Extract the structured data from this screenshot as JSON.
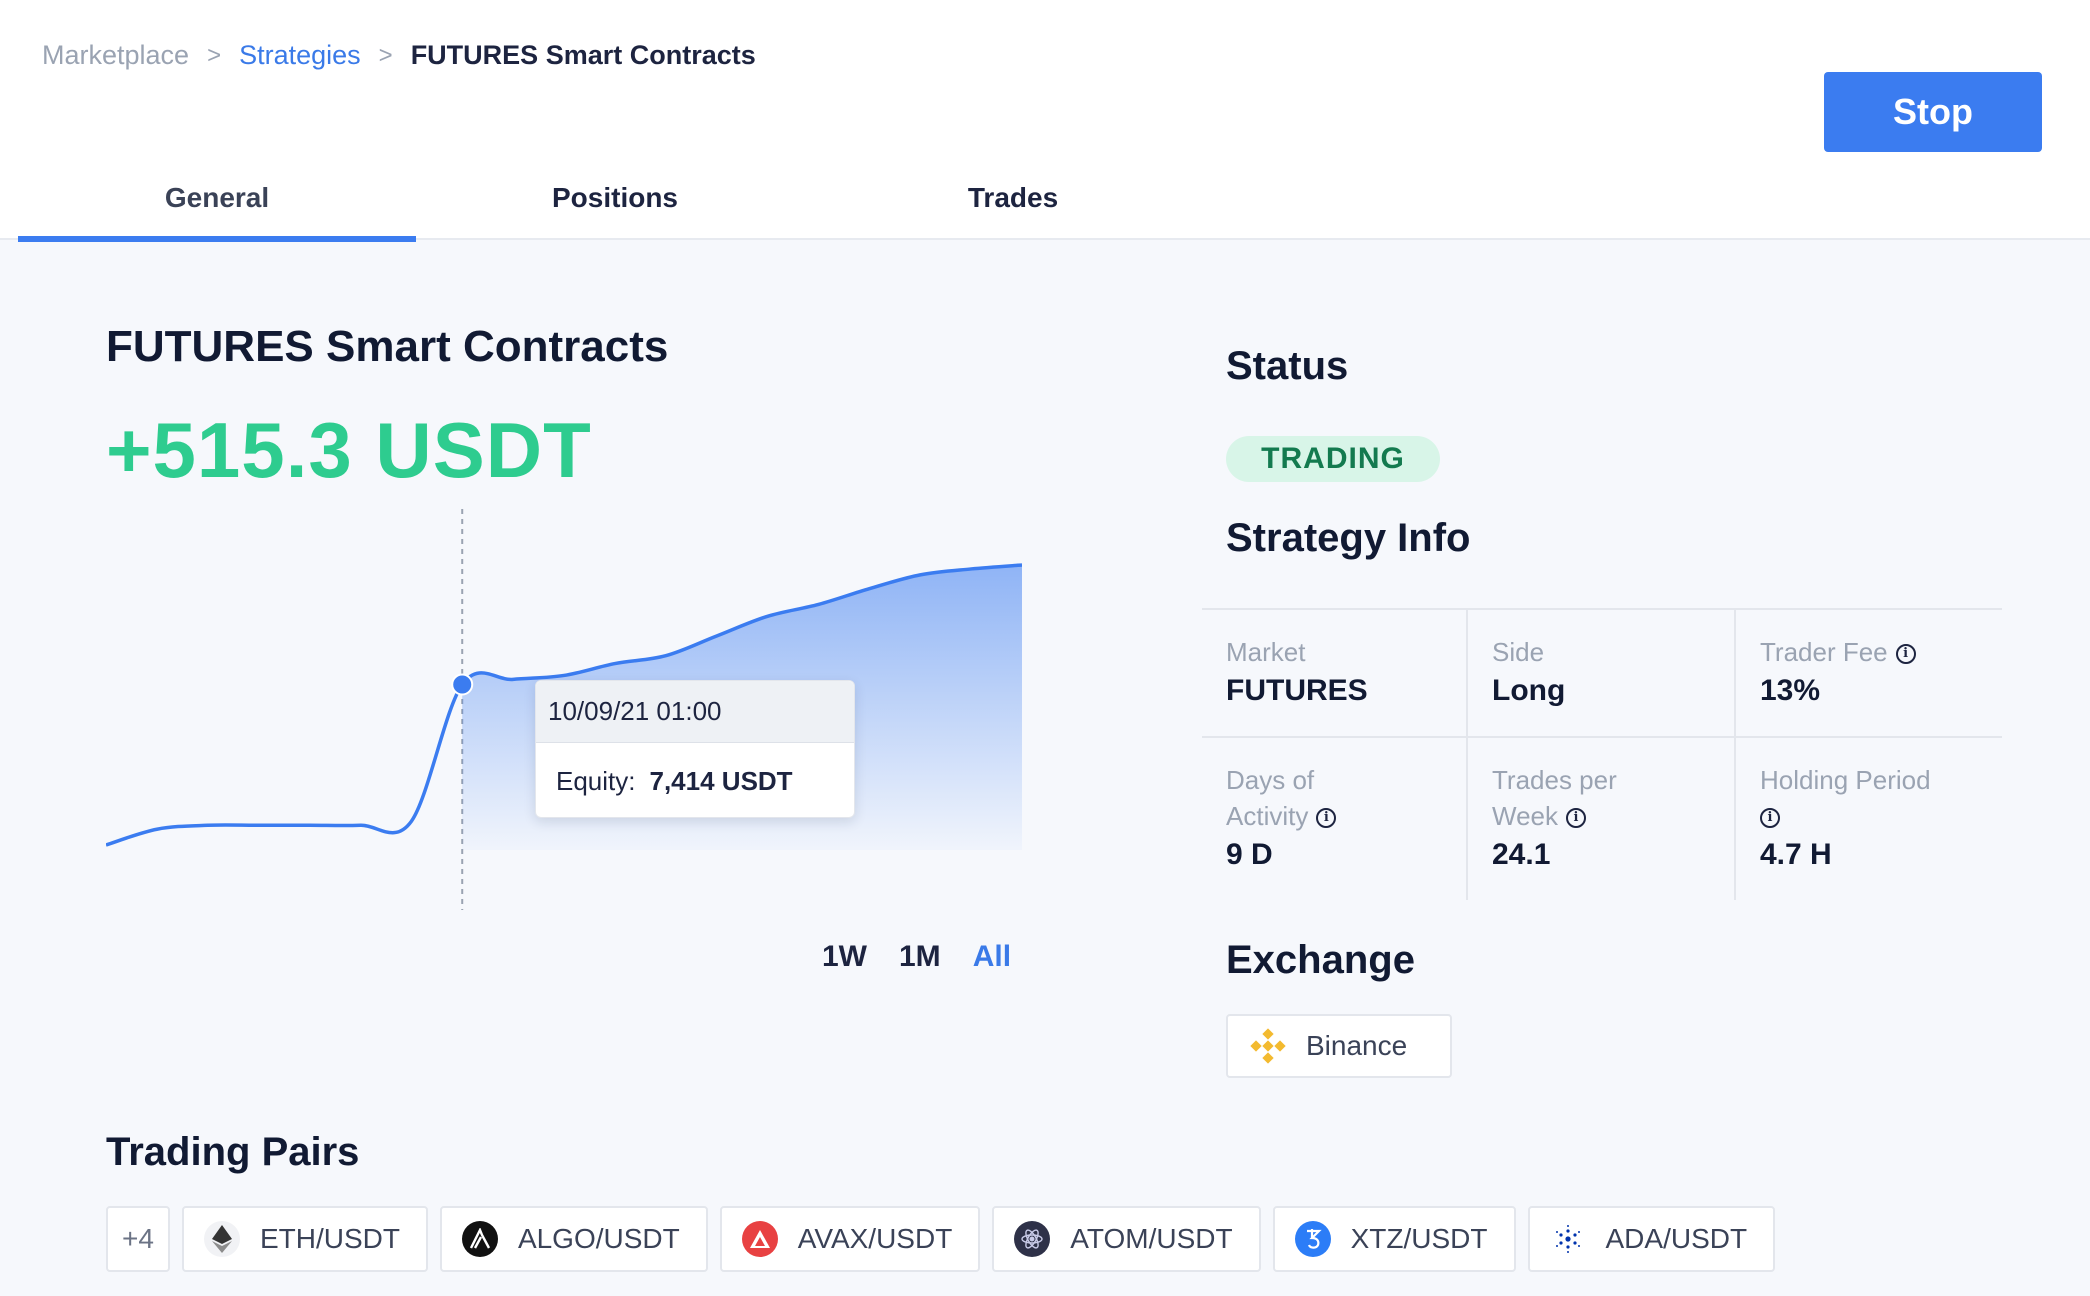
{
  "breadcrumb": {
    "root": "Marketplace",
    "parent": "Strategies",
    "current": "FUTURES Smart Contracts",
    "separator": ">"
  },
  "header": {
    "stop_label": "Stop"
  },
  "tabs": [
    {
      "label": "General",
      "active": true
    },
    {
      "label": "Positions",
      "active": false
    },
    {
      "label": "Trades",
      "active": false
    }
  ],
  "strategy": {
    "title": "FUTURES Smart Contracts",
    "pnl": "+515.3 USDT"
  },
  "chart": {
    "tooltip_date": "10/09/21 01:00",
    "tooltip_label": "Equity:",
    "tooltip_value": "7,414 USDT",
    "ranges": [
      "1W",
      "1M",
      "All"
    ],
    "active_range": "All",
    "line_color": "#3b7cf0"
  },
  "chart_data": {
    "type": "area",
    "title": "",
    "xlabel": "",
    "ylabel": "",
    "x": [
      0,
      1,
      2,
      3,
      4,
      5,
      6,
      7,
      8,
      9,
      10,
      11,
      12,
      13,
      14,
      15,
      16,
      17,
      18
    ],
    "series": [
      {
        "values": [
          6600,
          6680,
          6700,
          6700,
          6700,
          6700,
          6720,
          7414,
          7440,
          7460,
          7520,
          7560,
          7660,
          7760,
          7820,
          7900,
          7970,
          8000,
          8020
        ]
      }
    ],
    "highlight_index": 7,
    "grid": false,
    "legend": "none"
  },
  "status": {
    "heading": "Status",
    "badge": "TRADING",
    "badge_color": "#d8f5e8"
  },
  "info": {
    "heading": "Strategy Info",
    "market_label": "Market",
    "market_value": "FUTURES",
    "side_label": "Side",
    "side_value": "Long",
    "fee_label": "Trader Fee",
    "fee_value": "13%",
    "days_label_1": "Days of",
    "days_label_2": "Activity",
    "days_value": "9 D",
    "tpw_label_1": "Trades per",
    "tpw_label_2": "Week",
    "tpw_value": "24.1",
    "hold_label": "Holding Period",
    "hold_value": "4.7 H",
    "info_glyph": "i"
  },
  "exchange": {
    "heading": "Exchange",
    "name": "Binance",
    "icon": "binance-icon"
  },
  "pairs": {
    "heading": "Trading Pairs",
    "more": "+4",
    "items": [
      {
        "label": "ETH/USDT",
        "icon": "eth-icon"
      },
      {
        "label": "ALGO/USDT",
        "icon": "algo-icon"
      },
      {
        "label": "AVAX/USDT",
        "icon": "avax-icon"
      },
      {
        "label": "ATOM/USDT",
        "icon": "atom-icon"
      },
      {
        "label": "XTZ/USDT",
        "icon": "xtz-icon"
      },
      {
        "label": "ADA/USDT",
        "icon": "ada-icon"
      }
    ]
  }
}
